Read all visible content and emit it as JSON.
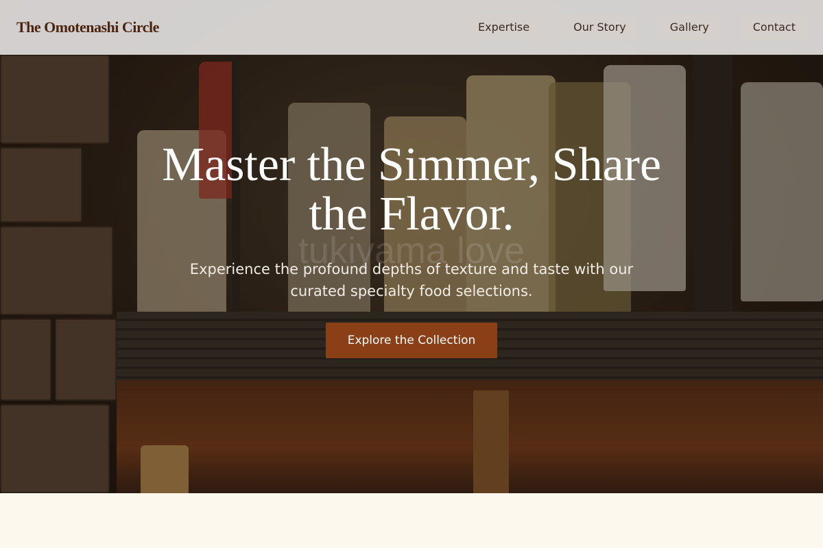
{
  "brand": {
    "name": "The Omotenashi Circle"
  },
  "nav": {
    "items": [
      "Expertise",
      "Our Story",
      "Gallery",
      "Contact"
    ]
  },
  "hero": {
    "headline": "Master the Simmer, Share the Flavor.",
    "subtext": "Experience the profound depths of texture and taste with our curated specialty food selections.",
    "cta_label": "Explore the Collection",
    "watermark": "tukiyama love"
  },
  "colors": {
    "brand_text": "#4a2410",
    "cta_background": "#8b3f17",
    "nav_background": "#e2e0de",
    "page_background": "#fdf8ee"
  }
}
